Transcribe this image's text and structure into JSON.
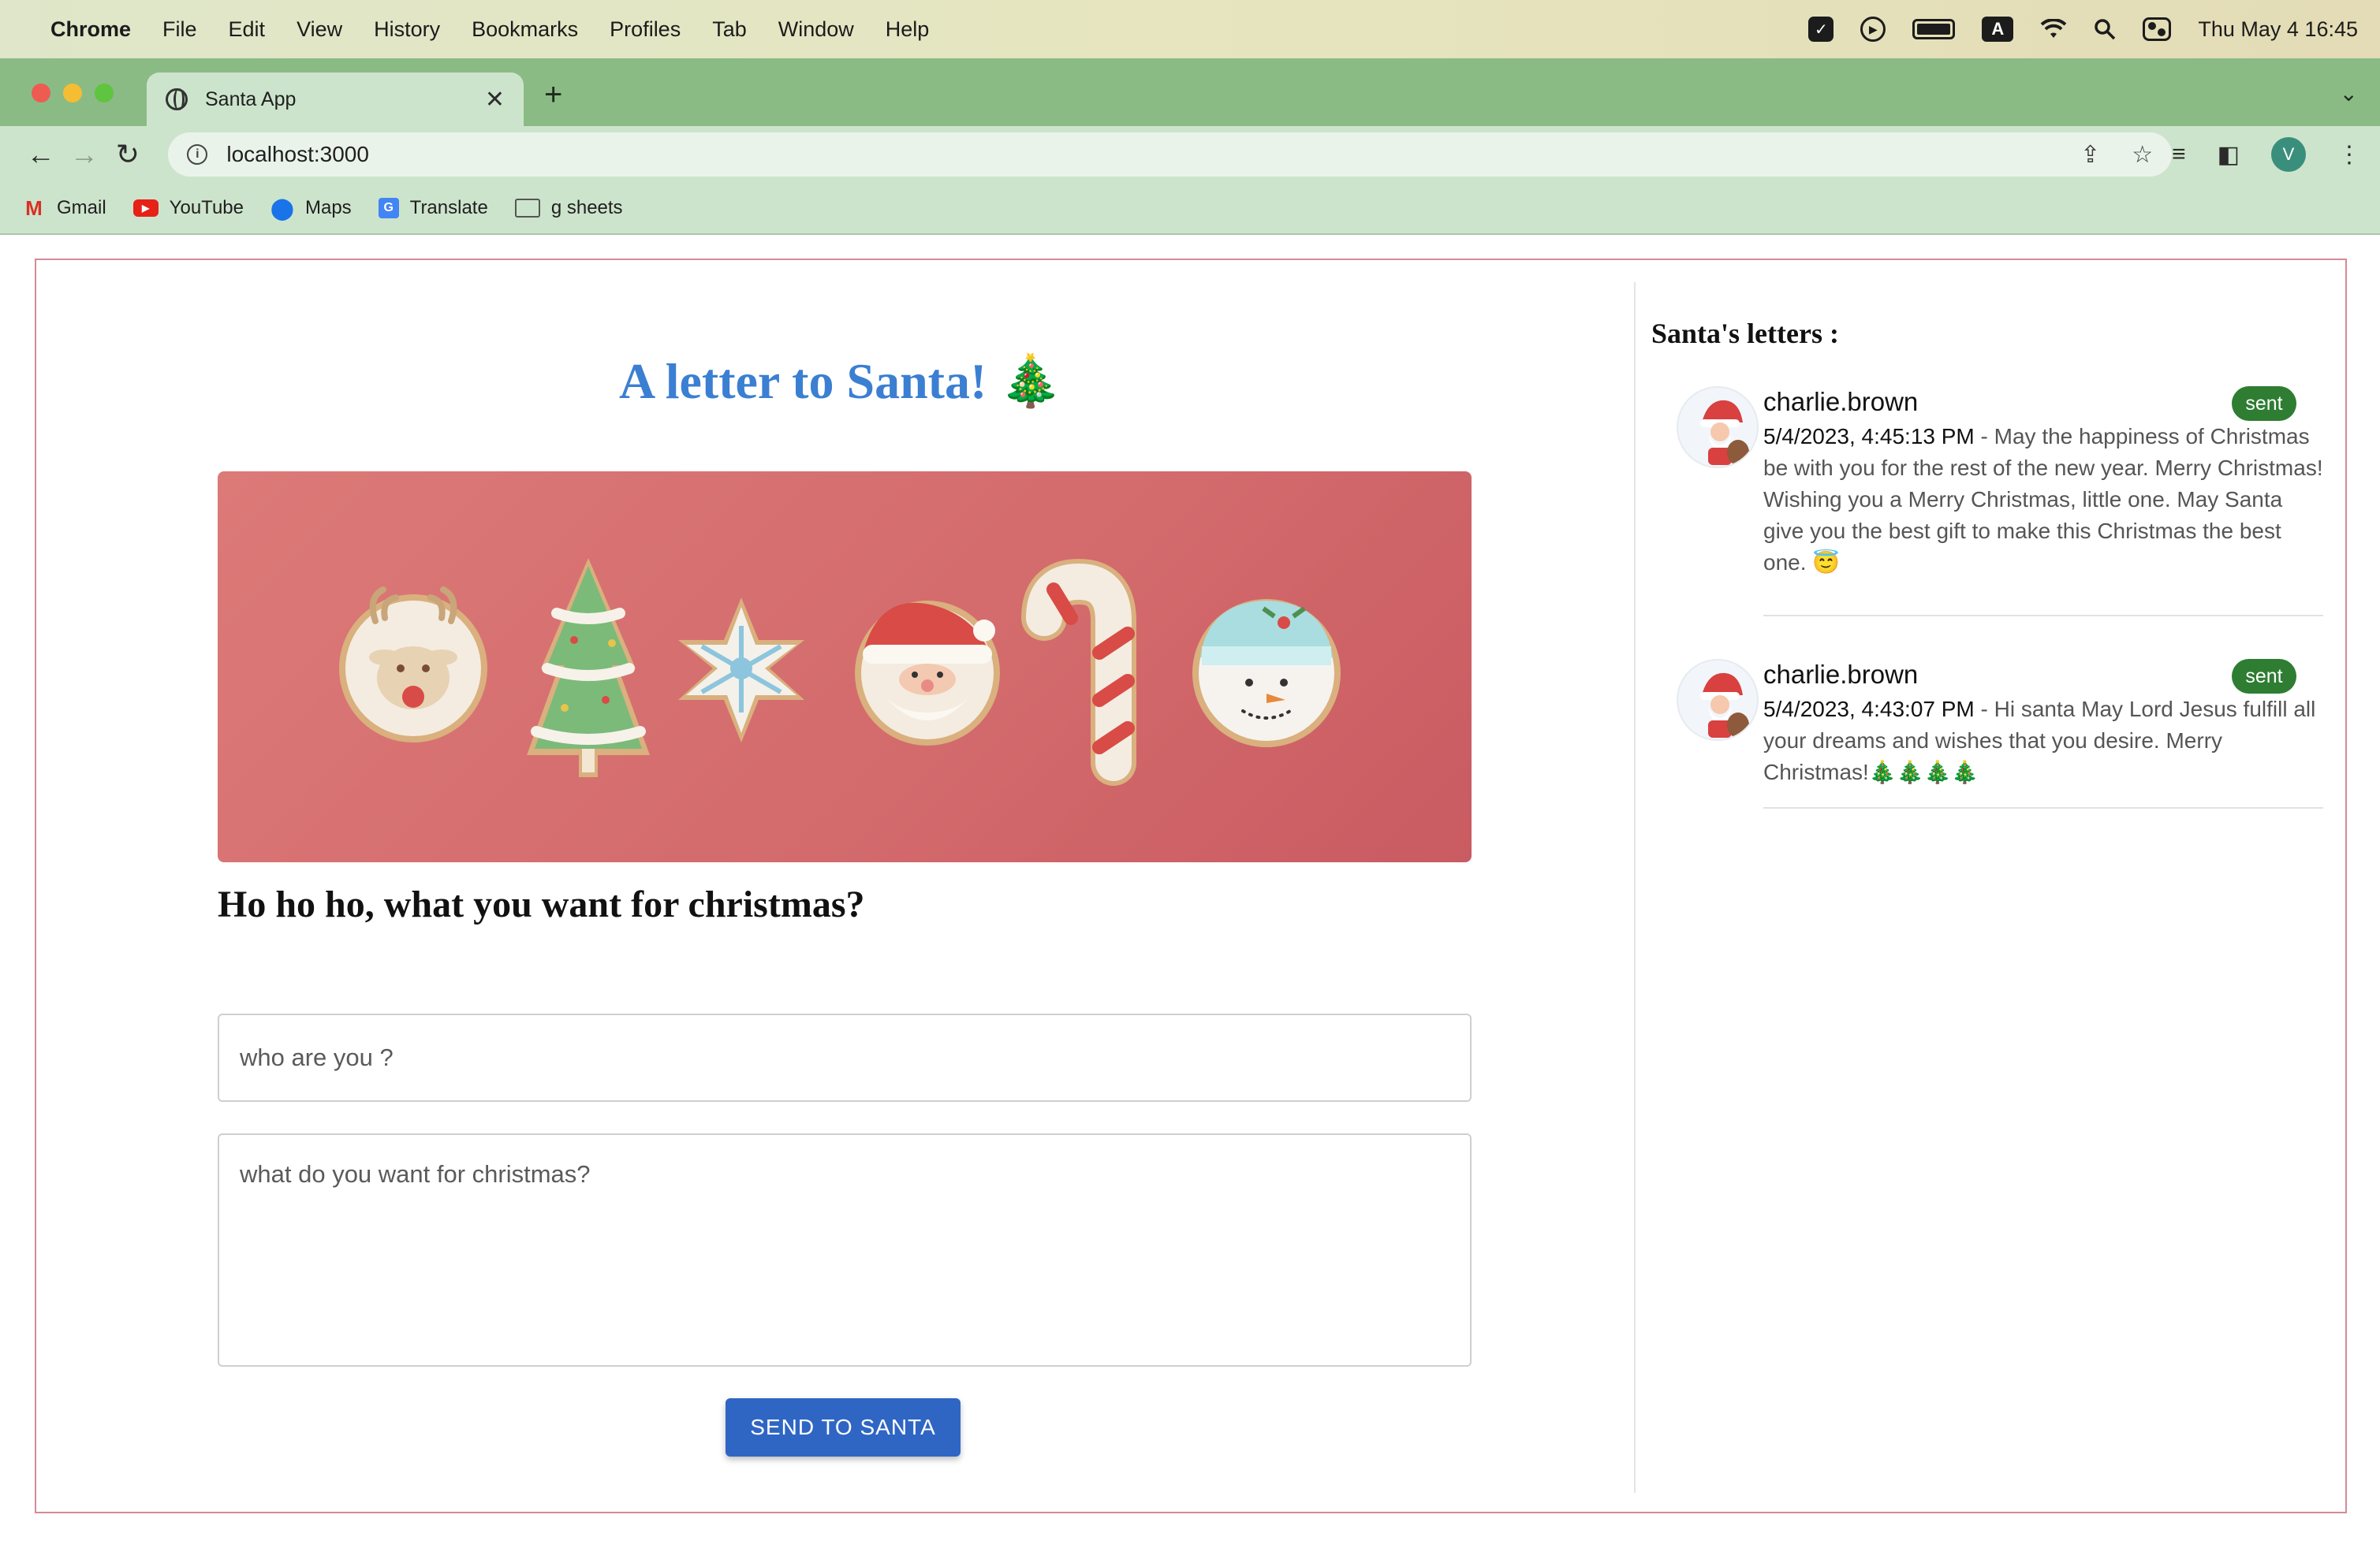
{
  "menubar": {
    "app_name": "Chrome",
    "items": [
      "File",
      "Edit",
      "View",
      "History",
      "Bookmarks",
      "Profiles",
      "Tab",
      "Window",
      "Help"
    ],
    "status_keyboard": "A",
    "clock": "Thu May 4  16:45"
  },
  "browser": {
    "tab_title": "Santa App",
    "url": "localhost:3000",
    "profile_initial": "V",
    "bookmarks": [
      "Gmail",
      "YouTube",
      "Maps",
      "Translate",
      "g sheets"
    ]
  },
  "app": {
    "title": "A letter to Santa! 🎄",
    "banner_alt": "Christmas cookies",
    "question": "Ho ho ho, what you want for christmas?",
    "name_placeholder": "who are you ?",
    "wish_placeholder": "what do you want for christmas?",
    "send_label": "SEND TO SANTA"
  },
  "letters": {
    "heading": "Santa's letters :",
    "items": [
      {
        "author": "charlie.brown",
        "timestamp": "5/4/2023, 4:45:13 PM",
        "separator": " - ",
        "message": "May the happiness of Christmas be with you for the rest of the new year. Merry Christmas! Wishing you a Merry Christmas, little one. May Santa give you the best gift to make this Christmas the best one. 😇",
        "status": "sent"
      },
      {
        "author": "charlie.brown",
        "timestamp": "5/4/2023, 4:43:07 PM",
        "separator": " - ",
        "message": "Hi santa May Lord Jesus fulfill all your dreams and wishes that you desire. Merry Christmas!🎄🎄🎄🎄",
        "status": "sent"
      }
    ]
  },
  "colors": {
    "title_blue": "#3b7fd2",
    "button_blue": "#2f66c4",
    "badge_green": "#2e7d32",
    "card_border": "#d58a97",
    "tab_green": "#8bbb85"
  }
}
